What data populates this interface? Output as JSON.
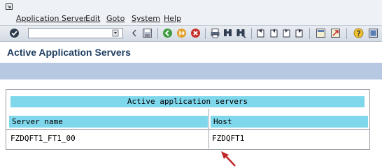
{
  "menu": {
    "items": [
      {
        "label": "Application Server"
      },
      {
        "label": "Edit"
      },
      {
        "label": "Goto"
      },
      {
        "label": "System"
      },
      {
        "label": "Help"
      }
    ]
  },
  "toolbar": {
    "command_field_value": "",
    "icons": [
      "enter-icon",
      "command-dropdown-icon",
      "back-arrow-icon",
      "save-icon",
      "back-icon",
      "exit-icon",
      "cancel-icon",
      "print-icon",
      "find-icon",
      "find-next-icon",
      "first-page-icon",
      "previous-page-icon",
      "next-page-icon",
      "last-page-icon",
      "create-session-icon",
      "shortcut-icon",
      "help-icon",
      "layout-menu-icon"
    ]
  },
  "page": {
    "title": "Active Application Servers"
  },
  "server_list": {
    "title": "Active application servers",
    "columns": [
      "Server name",
      "Host"
    ],
    "rows": [
      [
        "FZDQFT1_FT1_00",
        "FZDQFT1"
      ]
    ]
  },
  "colors": {
    "header_cyan": "#7fd7ec",
    "app_toolbar": "#b7c8e2",
    "title_text": "#1f3f63",
    "arrow": "#c0282a"
  }
}
